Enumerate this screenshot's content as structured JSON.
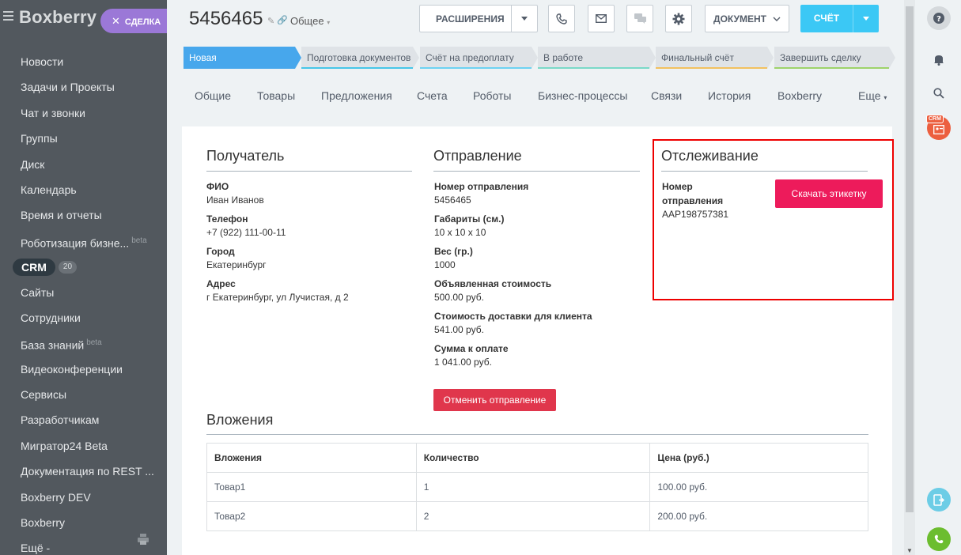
{
  "sidebar": {
    "brand": "Boxberry",
    "deal_button": "СДЕЛКА",
    "items": [
      {
        "label": "Новости"
      },
      {
        "label": "Задачи и Проекты"
      },
      {
        "label": "Чат и звонки"
      },
      {
        "label": "Группы"
      },
      {
        "label": "Диск"
      },
      {
        "label": "Календарь"
      },
      {
        "label": "Время и отчеты"
      },
      {
        "label": "Роботизация бизне...",
        "badge": "beta"
      },
      {
        "label": "CRM",
        "count": "20"
      },
      {
        "label": "Сайты"
      },
      {
        "label": "Сотрудники"
      },
      {
        "label": "База знаний",
        "badge": "beta"
      },
      {
        "label": "Видеоконференции"
      },
      {
        "label": "Сервисы"
      },
      {
        "label": "Разработчикам"
      },
      {
        "label": "Мигратор24 Beta"
      },
      {
        "label": "Документация по REST ..."
      },
      {
        "label": "Boxberry DEV"
      },
      {
        "label": "Boxberry"
      },
      {
        "label": "Ещё -"
      }
    ]
  },
  "header": {
    "deal_id": "5456465",
    "category": "Общее",
    "extensions_label": "РАСШИРЕНИЯ",
    "document_label": "ДОКУМЕНТ",
    "invoice_label": "СЧЁТ",
    "icons": [
      "phone-icon",
      "mail-icon",
      "chat-icon",
      "gear-icon"
    ]
  },
  "stages": [
    {
      "label": "Новая",
      "color": "#47a7ec",
      "active": true
    },
    {
      "label": "Подготовка документов",
      "color": "#47c6e8"
    },
    {
      "label": "Счёт на предоплату",
      "color": "#6dd2f2"
    },
    {
      "label": "В работе",
      "color": "#7ad9c8"
    },
    {
      "label": "Финальный счёт",
      "color": "#f2c15f"
    },
    {
      "label": "Завершить сделку",
      "color": "#9ed36a"
    }
  ],
  "tabs": [
    "Общие",
    "Товары",
    "Предложения",
    "Счета",
    "Роботы",
    "Бизнес-процессы",
    "Связи",
    "История",
    "Boxberry",
    "Еще"
  ],
  "recipient": {
    "title": "Получатель",
    "fields": [
      {
        "label": "ФИО",
        "value": "Иван Иванов"
      },
      {
        "label": "Телефон",
        "value": "+7 (922) 111-00-11"
      },
      {
        "label": "Город",
        "value": "Екатеринбург"
      },
      {
        "label": "Адрес",
        "value": "г Екатеринбург, ул Лучистая, д 2"
      }
    ]
  },
  "shipment": {
    "title": "Отправление",
    "fields": [
      {
        "label": "Номер отправления",
        "value": "5456465"
      },
      {
        "label": "Габариты (см.)",
        "value": "10 x 10 x 10"
      },
      {
        "label": "Вес (гр.)",
        "value": "1000"
      },
      {
        "label": "Объявленная стоимость",
        "value": "500.00 руб."
      },
      {
        "label": "Стоимость доставки для клиента",
        "value": "541.00 руб."
      },
      {
        "label": "Сумма к оплате",
        "value": "1 041.00 руб."
      }
    ],
    "cancel_button": "Отменить отправление"
  },
  "tracking": {
    "title": "Отслеживание",
    "number_label": "Номер отправления",
    "number_value": "AAP198757381",
    "download_button": "Скачать этикетку"
  },
  "attachments": {
    "title": "Вложения",
    "columns": [
      "Вложения",
      "Количество",
      "Цена (руб.)"
    ],
    "rows": [
      [
        "Товар1",
        "1",
        "100.00 руб."
      ],
      [
        "Товар2",
        "2",
        "200.00 руб."
      ]
    ]
  },
  "rail": {
    "crm_badge": "CRM"
  }
}
